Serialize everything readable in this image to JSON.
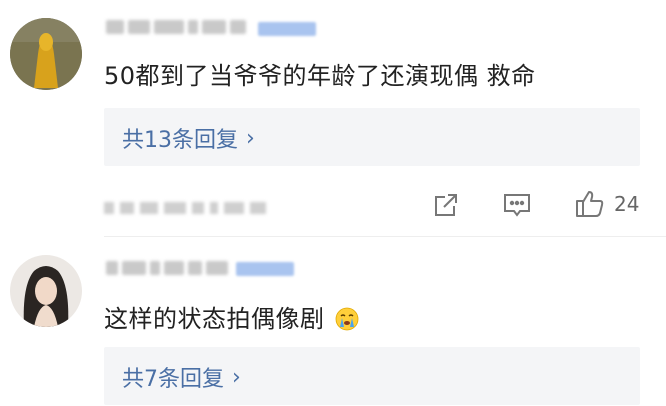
{
  "comments": [
    {
      "text": "50都到了当爷爷的年龄了还演现偶 救命",
      "reply_label": "共13条回复",
      "reply_chevron": "›",
      "like_count": "24"
    },
    {
      "text": "这样的状态拍偶像剧",
      "emoji": "crying-face-icon",
      "reply_label": "共7条回复",
      "reply_chevron": "›"
    }
  ],
  "colors": {
    "link": "#4a6fa5",
    "reply_bg": "#f4f5f7",
    "text": "#222222"
  },
  "icons": [
    "share-icon",
    "comment-icon",
    "thumbs-up-icon"
  ]
}
